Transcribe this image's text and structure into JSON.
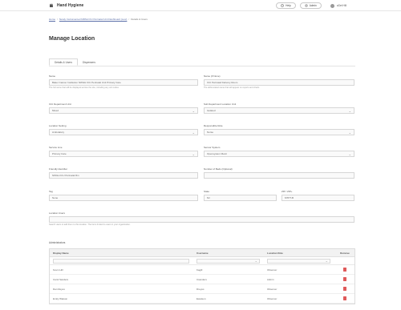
{
  "app": {
    "title": "Hand Hygiene"
  },
  "header": {
    "help_label": "Help",
    "admin_label": "Admin",
    "user_name": "uGet Hill"
  },
  "breadcrumb": {
    "home": "Home",
    "parent": "Newly Instrumented MRSA ICU Perinatal Unit Dashboard (Low)",
    "current": "Details & Users"
  },
  "page": {
    "title": "Manage Location"
  },
  "tabs": [
    {
      "label": "Details & Users"
    },
    {
      "label": "Dispensers"
    }
  ],
  "form": {
    "name": {
      "label": "Name",
      "value": "Baker Cancer Institution NWGH ICU Perinatal Unit Primary Care",
      "hint": "The full name that will be displayed across the site, including any unit codes"
    },
    "name_for_reports": {
      "label": "Name (If None)",
      "value": "ICU Perinatal Delivery Room",
      "hint": "The abbreviated name that will appear on reports and charts"
    },
    "department": {
      "label": "ICU Department Unit",
      "value": "Mixed"
    },
    "sub_department": {
      "label": "Sub Department Location Unit",
      "value": "Isolated"
    },
    "location_setting": {
      "label": "Location Setting",
      "value": "Ambulatory"
    },
    "responsible_role": {
      "label": "Responsible Role",
      "value": "Nurse"
    },
    "service_line": {
      "label": "Service Line",
      "value": "Primary Care"
    },
    "sensor_system": {
      "label": "Sensor System",
      "value": "Opensystem Metrc"
    },
    "friendly_name": {
      "label": "Friendly Identifier",
      "value": "NWGH ICU Perinatal Rm"
    },
    "number_of_beds": {
      "label": "Number of Beds (Optional)",
      "value": ""
    },
    "tag": {
      "label": "Tag",
      "value": "None"
    },
    "state": {
      "label": "State",
      "value": "Nil"
    },
    "zip": {
      "label": "ZIP / ZIP+",
      "value": "MTPT-B"
    },
    "location_users": {
      "label": "Location Users",
      "value": "",
      "hint": "Search users to add them to this location. The list is limited to users in your organization."
    }
  },
  "members": {
    "title": "Administrators",
    "columns": [
      "Display Name",
      "Username",
      "Location Role",
      "Remove"
    ],
    "rows": [
      {
        "name": "Kevin Hill",
        "username": "Kagill",
        "role": "Observer"
      },
      {
        "name": "Carol Sanders",
        "username": "Csanders",
        "role": "Admin"
      },
      {
        "name": "Dan Reyes",
        "username": "Dreyes",
        "role": "Observer"
      },
      {
        "name": "Emily Watson",
        "username": "Ewatson",
        "role": "Observer"
      }
    ]
  },
  "colors": {
    "accent": "#5b6fa8",
    "danger": "#e05a5a"
  }
}
